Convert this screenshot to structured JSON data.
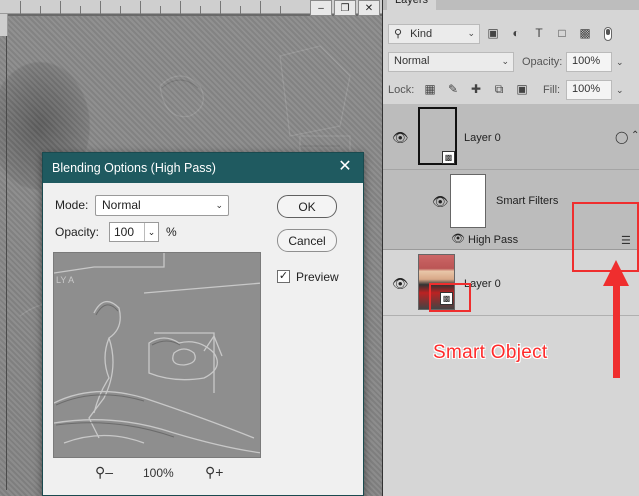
{
  "layers_panel": {
    "tab_label": "Layers",
    "kind_filter": "Kind",
    "blend_mode": "Normal",
    "opacity_label": "Opacity:",
    "opacity_value": "100%",
    "lock_label": "Lock:",
    "fill_label": "Fill:",
    "fill_value": "100%",
    "layers": [
      {
        "name": "Layer 0"
      },
      {
        "name": "Smart Filters"
      },
      {
        "name": "High Pass"
      },
      {
        "name": "Layer 0"
      }
    ]
  },
  "dialog": {
    "title": "Blending Options (High Pass)",
    "mode_label": "Mode:",
    "mode_value": "Normal",
    "opacity_label": "Opacity:",
    "opacity_value": "100",
    "percent_sign": "%",
    "ok_label": "OK",
    "cancel_label": "Cancel",
    "preview_label": "Preview",
    "preview_checked": true,
    "zoom_level": "100%"
  },
  "annotation": {
    "smart_object_label": "Smart Object",
    "color": "#ef2e2e"
  },
  "colors": {
    "dialog_titlebar": "#1f5a60",
    "selected_layer": "#bcbcbc",
    "panel_bg": "#d6d6d6"
  },
  "icons": {
    "search": "search-icon",
    "close": "close-icon",
    "eye": "eye-icon",
    "zoom_in": "zoom-in-icon",
    "zoom_out": "zoom-out-icon",
    "smart_object": "smart-object-icon"
  }
}
